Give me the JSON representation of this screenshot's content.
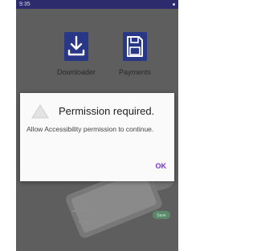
{
  "status_bar": {
    "time": "9:35"
  },
  "home": {
    "downloader_label": "Downloader",
    "payments_label": "Payments"
  },
  "dialog": {
    "title": "Permission required.",
    "message": "Allow Accessibility permission to continue.",
    "ok_label": "OK"
  },
  "background": {
    "badge_text": "Save"
  },
  "colors": {
    "accent": "#7b2fdc",
    "tile": "#283786",
    "status_bar": "#2d2a6e",
    "scrim": "#5e5e5e"
  }
}
